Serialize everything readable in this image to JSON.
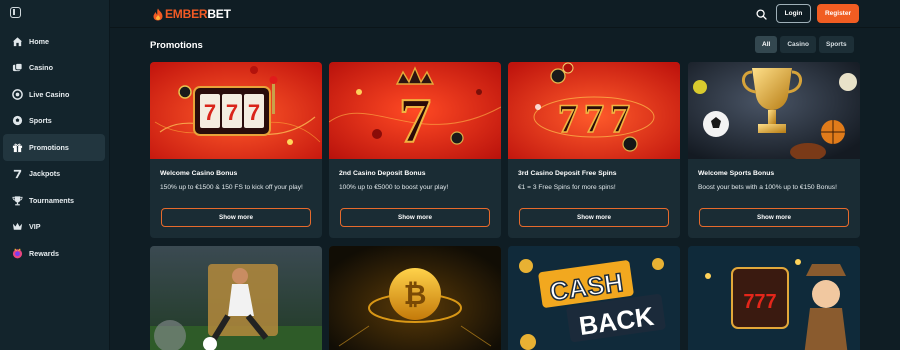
{
  "brand": {
    "name_part1": "EMBER",
    "name_part2": "BET"
  },
  "header": {
    "login_label": "Login",
    "register_label": "Register"
  },
  "sidebar": {
    "items": [
      {
        "label": "Home",
        "icon": "home-icon"
      },
      {
        "label": "Casino",
        "icon": "casino-chip-icon"
      },
      {
        "label": "Live Casino",
        "icon": "live-casino-icon"
      },
      {
        "label": "Sports",
        "icon": "soccer-ball-icon"
      },
      {
        "label": "Promotions",
        "icon": "gift-icon",
        "active": true
      },
      {
        "label": "Jackpots",
        "icon": "seven-icon"
      },
      {
        "label": "Tournaments",
        "icon": "trophy-icon"
      },
      {
        "label": "VIP",
        "icon": "crown-icon"
      },
      {
        "label": "Rewards",
        "icon": "rewards-icon"
      }
    ]
  },
  "main": {
    "title": "Promotions",
    "filters": [
      {
        "label": "All",
        "active": true
      },
      {
        "label": "Casino"
      },
      {
        "label": "Sports"
      }
    ],
    "cards": [
      {
        "title": "Welcome Casino Bonus",
        "description": "150% up to €1500 & 150 FS to kick off your play!",
        "button": "Show more"
      },
      {
        "title": "2nd Casino Deposit Bonus",
        "description": "100% up to €5000 to boost your play!",
        "button": "Show more"
      },
      {
        "title": "3rd Casino Deposit Free Spins",
        "description": "€1 = 3 Free Spins for more spins!",
        "button": "Show more"
      },
      {
        "title": "Welcome Sports Bonus",
        "description": "Boost your bets with a 100% up to €150 Bonus!",
        "button": "Show more"
      }
    ],
    "second_row_images": [
      "cash-back-art-label"
    ],
    "cashback_text_1": "CASH",
    "cashback_text_2": "BACK"
  },
  "colors": {
    "accent": "#f15d22",
    "background": "#0f1d24",
    "card": "#1a2c34",
    "sidebar": "#13242c"
  }
}
